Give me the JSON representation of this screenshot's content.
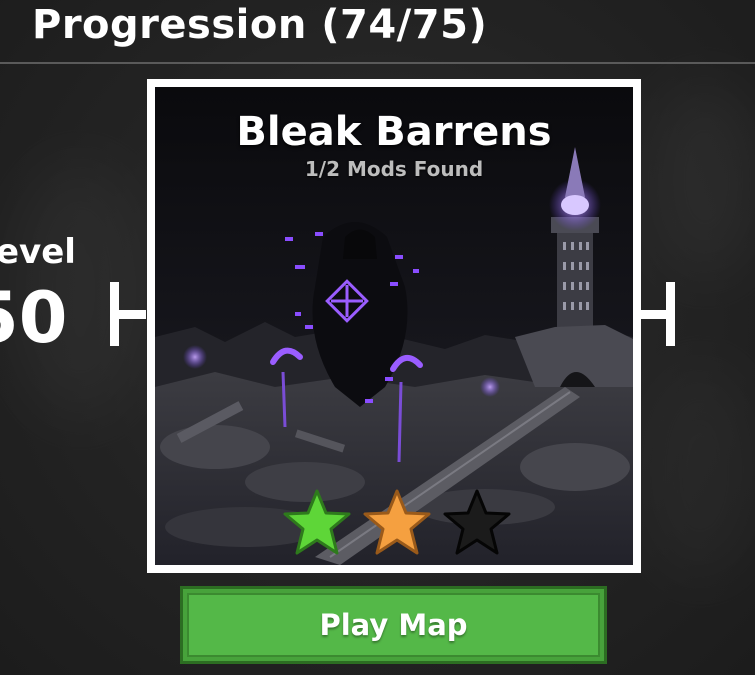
{
  "header": {
    "title": "Progression (74/75)"
  },
  "level": {
    "label": "evel",
    "value": "50"
  },
  "map_card": {
    "name": "Bleak Barrens",
    "mods_found": "1/2 Mods Found",
    "stars": [
      {
        "state": "earned",
        "color": "#5ed638"
      },
      {
        "state": "earned",
        "color": "#f5a040"
      },
      {
        "state": "locked",
        "color": "#1b1b1b"
      }
    ]
  },
  "actions": {
    "play_label": "Play Map"
  },
  "colors": {
    "play_button": "#54b848",
    "card_border": "#ffffff",
    "accent_purple": "#8a4dff"
  }
}
